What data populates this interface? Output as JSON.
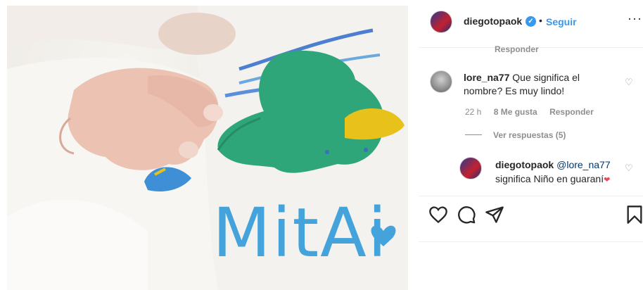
{
  "photo": {
    "caption": "MitAi",
    "colors": {
      "background": "#ebe8e2",
      "fish_green": "#2fa57a",
      "fish_beak": "#e8c11a",
      "caption_blue": "#45a3dc"
    }
  },
  "header": {
    "username": "diegotopaok",
    "verified_icon": "verified-badge-icon",
    "separator": "•",
    "follow_label": "Seguir",
    "more_icon": "more-options-icon",
    "more_glyph": "···"
  },
  "comments": {
    "prev_reply_label": "Responder",
    "first": {
      "username": "lore_na77",
      "text": "Que significa el nombre? Es muy lindo!",
      "time": "22 h",
      "likes": "8 Me gusta",
      "reply_label": "Responder",
      "view_replies": "Ver respuestas (5)"
    },
    "reply": {
      "username": "diegotopaok",
      "mention": "@lore_na77",
      "text": "significa Niño en guaraní"
    }
  },
  "actions": {
    "like_icon": "heart-icon",
    "comment_icon": "comment-icon",
    "share_icon": "share-icon",
    "save_icon": "bookmark-icon"
  },
  "colors": {
    "link_blue": "#3897f0",
    "muted": "#8e8e8e",
    "text": "#262626",
    "heart_red": "#ed4956"
  }
}
